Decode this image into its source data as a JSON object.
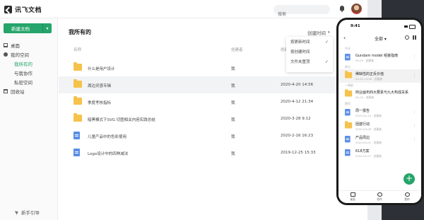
{
  "app": {
    "name": "讯飞文档"
  },
  "header": {
    "search_placeholder": "搜索"
  },
  "sidebar": {
    "new_button": "新建文档",
    "items": [
      {
        "label": "桌面",
        "icon": "desktop-icon"
      },
      {
        "label": "我的空间",
        "icon": "space-icon"
      },
      {
        "label": "我所有的",
        "active": true
      },
      {
        "label": "与我协作"
      },
      {
        "label": "私密空间"
      },
      {
        "label": "回收站",
        "icon": "trash-icon"
      }
    ],
    "guide": "新手引导"
  },
  "main": {
    "title": "我所有的",
    "sort_label": "创建时间",
    "columns": {
      "name": "名称",
      "owner": "创建者",
      "time": "创建时间"
    },
    "rows": [
      {
        "type": "folder",
        "name": "什么是用户设计",
        "owner": "我",
        "time": ""
      },
      {
        "type": "folder",
        "name": "周边灵感专辑",
        "owner": "我",
        "time": "2020-4-20 14:56"
      },
      {
        "type": "folder",
        "name": "季度考核指标",
        "owner": "我",
        "time": "2020-4-12 21:34"
      },
      {
        "type": "folder",
        "name": "暗黑模式下SVG 切图相关内容实践总结",
        "owner": "我",
        "time": "2020-3-28 9:12"
      },
      {
        "type": "doc",
        "name": "儿童产品中的色彩使用",
        "owner": "我",
        "time": "2020-2-16 16:23"
      },
      {
        "type": "doc",
        "name": "Logo设计中的四种减法",
        "owner": "我",
        "time": "2019-12-25 15:33"
      }
    ]
  },
  "sort_menu": {
    "items": [
      {
        "label": "按更新时间",
        "checked": true
      },
      {
        "label": "按创建时间",
        "checked": false
      },
      {
        "label": "文件夹置顶",
        "checked": true
      }
    ]
  },
  "phone": {
    "time": "9:41",
    "filter": "全部",
    "sections": [
      "今天",
      "昨天",
      "一周前",
      "更早"
    ],
    "items": [
      {
        "type": "doc",
        "title": "Gundam model 组装指南",
        "sub": "09:29 · 创建者"
      },
      {
        "type": "folder",
        "title": "稀缺性的正反价值",
        "sub": "04-20 14:56 · 创建者"
      },
      {
        "type": "folder",
        "title": "商业画布四大要素与九大构成关系",
        "sub": "04-20 · 创建者"
      },
      {
        "type": "doc",
        "title": "周一报告",
        "sub": "2020-04-14 · 创建者"
      },
      {
        "type": "folder",
        "title": "团建行动",
        "sub": "2020-04-08 · 创建者"
      },
      {
        "type": "doc",
        "title": "产品周边",
        "sub": "2020-04-01 · 创建者"
      },
      {
        "type": "doc",
        "title": "618方案",
        "sub": "2020-03-27 · 创建者"
      }
    ],
    "tabs": [
      "桌面",
      "协作",
      "我的"
    ]
  },
  "colors": {
    "accent": "#25a56a",
    "folder": "#f5c24b",
    "doc": "#5b8ee6"
  }
}
